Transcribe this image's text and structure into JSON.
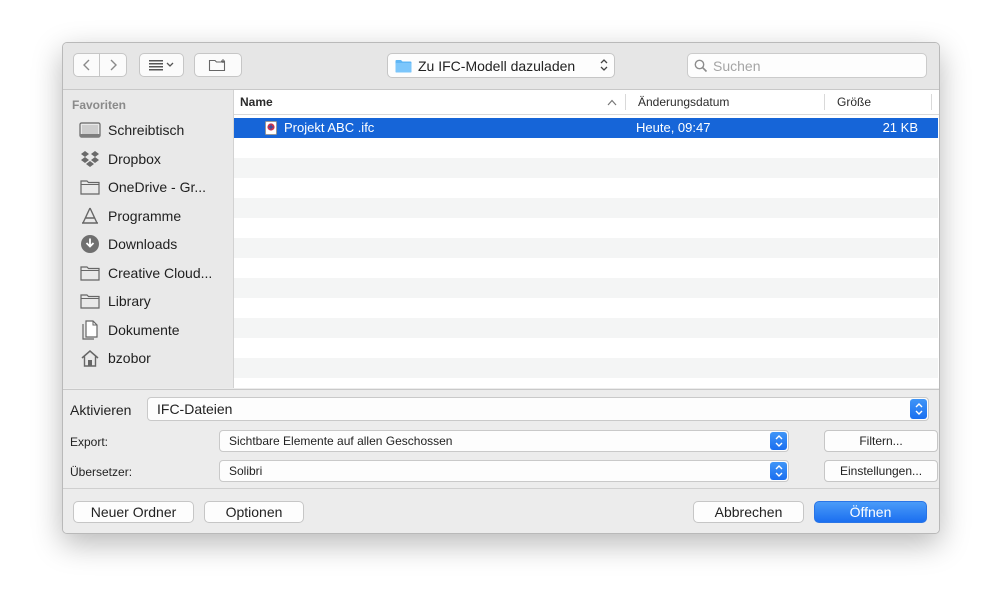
{
  "toolbar": {
    "back_icon": "chevron-left-icon",
    "forward_icon": "chevron-right-icon",
    "view_icon": "list-view-icon",
    "new_folder_icon": "new-folder-icon",
    "path_label": "Zu IFC-Modell dazuladen",
    "search_placeholder": "Suchen"
  },
  "sidebar": {
    "section_title": "Favoriten",
    "items": [
      {
        "label": "Schreibtisch",
        "icon": "desktop-icon"
      },
      {
        "label": "Dropbox",
        "icon": "dropbox-icon"
      },
      {
        "label": "OneDrive - Gr...",
        "icon": "folder-icon"
      },
      {
        "label": "Programme",
        "icon": "applications-icon"
      },
      {
        "label": "Downloads",
        "icon": "downloads-icon"
      },
      {
        "label": "Creative Cloud...",
        "icon": "folder-icon"
      },
      {
        "label": "Library",
        "icon": "folder-icon"
      },
      {
        "label": "Dokumente",
        "icon": "documents-icon"
      },
      {
        "label": "bzobor",
        "icon": "home-icon"
      }
    ]
  },
  "filelist": {
    "columns": {
      "name": "Name",
      "date": "Änderungsdatum",
      "size": "Größe"
    },
    "files": [
      {
        "name": "Projekt ABC  .ifc",
        "date": "Heute, 09:47",
        "size": "21 KB",
        "selected": true
      }
    ]
  },
  "options": {
    "activate_label": "Aktivieren",
    "activate_value": "IFC-Dateien",
    "export_label": "Export:",
    "export_value": "Sichtbare Elemente auf allen Geschossen",
    "filter_button": "Filtern...",
    "translator_label": "Übersetzer:",
    "translator_value": "Solibri",
    "settings_button": "Einstellungen..."
  },
  "footer": {
    "new_folder": "Neuer Ordner",
    "options": "Optionen",
    "cancel": "Abbrechen",
    "open": "Öffnen"
  },
  "colors": {
    "accent": "#1665d8",
    "selection": "#1665d8"
  }
}
